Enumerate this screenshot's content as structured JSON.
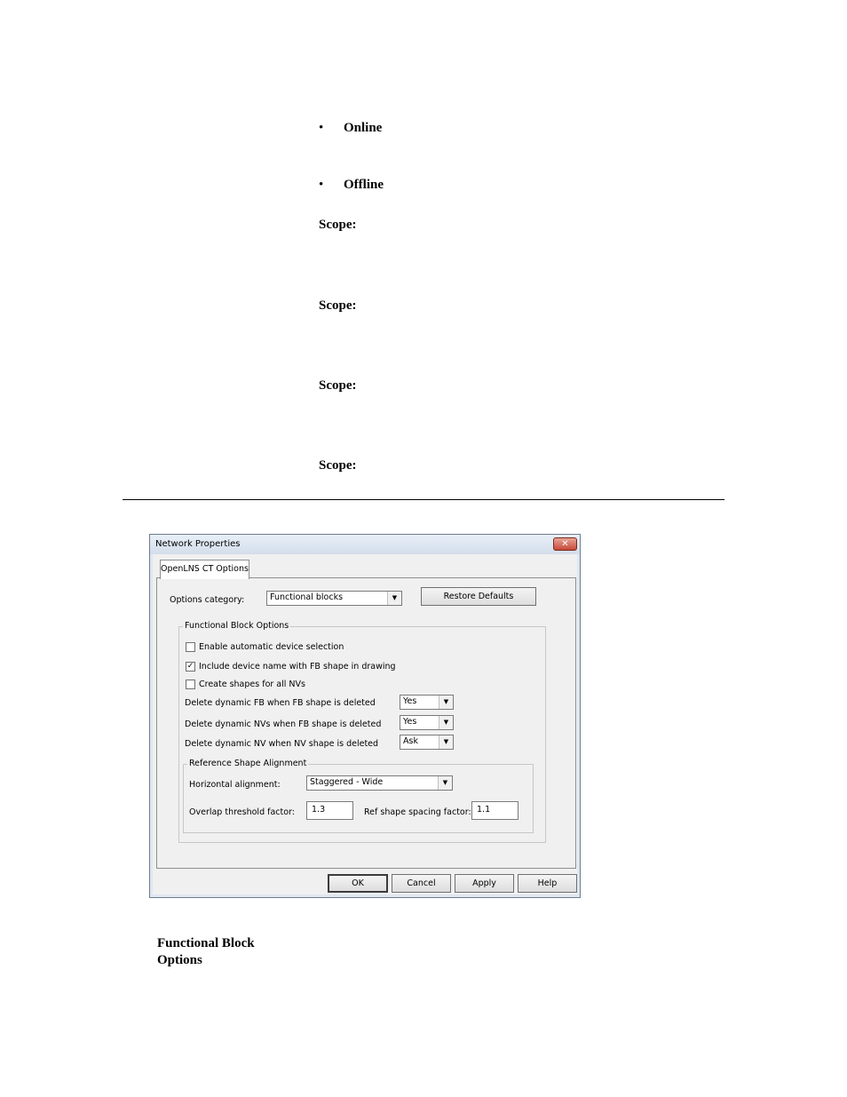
{
  "document": {
    "bullets": [
      "Online",
      "Offline"
    ],
    "scope_labels": [
      "Scope:",
      "Scope:",
      "Scope:",
      "Scope:"
    ],
    "caption_line1": "Functional Block",
    "caption_line2": "Options"
  },
  "dialog": {
    "title": "Network Properties",
    "close_glyph": "✕",
    "tab_label": "OpenLNS CT Options",
    "options_category_label": "Options category:",
    "options_category_value": "Functional blocks",
    "restore_defaults_label": "Restore Defaults",
    "group_title": "Functional Block Options",
    "checkboxes": [
      {
        "label": "Enable automatic device selection",
        "checked": false
      },
      {
        "label": "Include device name with FB shape in drawing",
        "checked": true
      },
      {
        "label": "Create shapes for all NVs",
        "checked": false
      }
    ],
    "dropdown_rows": [
      {
        "label": "Delete dynamic FB when FB shape is deleted",
        "value": "Yes"
      },
      {
        "label": "Delete dynamic NVs when FB shape is deleted",
        "value": "Yes"
      },
      {
        "label": "Delete dynamic NV when NV shape is deleted",
        "value": "Ask"
      }
    ],
    "reference_group_title": "Reference Shape Alignment",
    "horizontal_alignment_label": "Horizontal alignment:",
    "horizontal_alignment_value": "Staggered - Wide",
    "overlap_label": "Overlap threshold factor:",
    "overlap_value": "1.3",
    "spacing_label": "Ref shape spacing factor:",
    "spacing_value": "1.1",
    "buttons": {
      "ok": "OK",
      "cancel": "Cancel",
      "apply": "Apply",
      "help": "Help"
    },
    "check_glyph": "✓",
    "arrow_glyph": "▼"
  }
}
